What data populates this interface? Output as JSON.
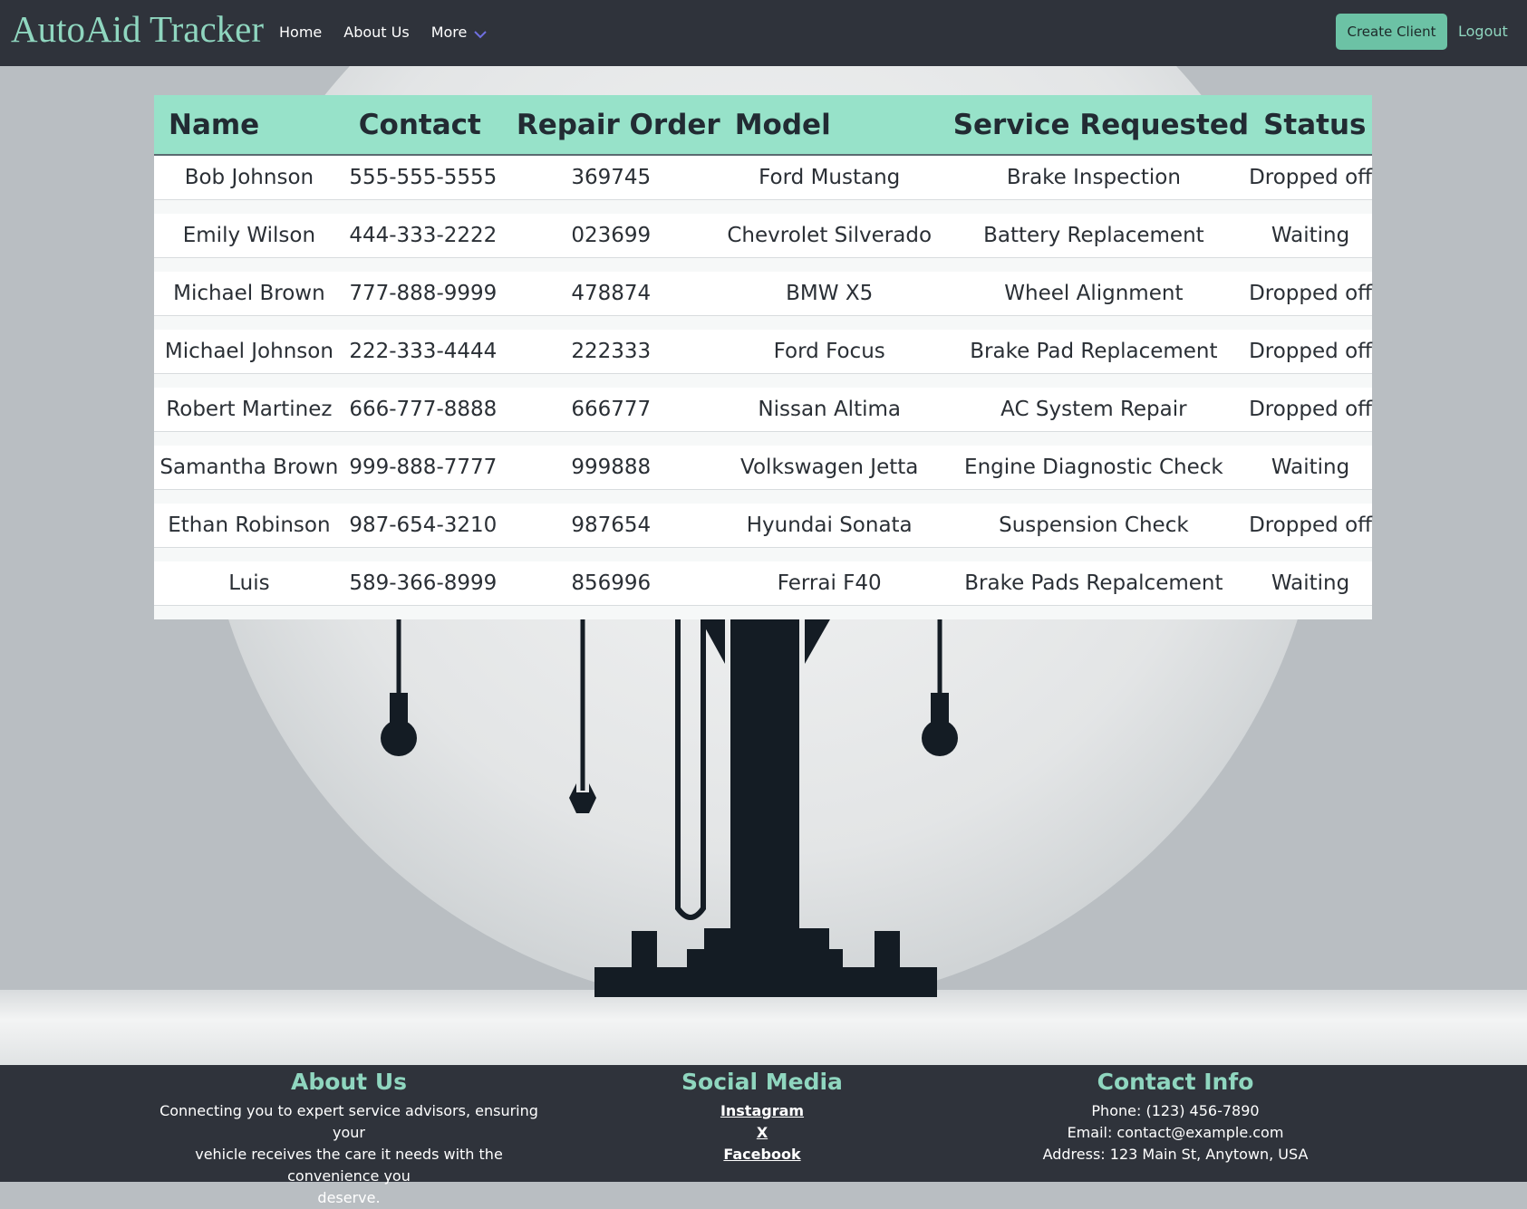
{
  "nav": {
    "brand": "AutoAid Tracker",
    "links": [
      "Home",
      "About Us",
      "More"
    ],
    "create_label": "Create Client",
    "logout_label": "Logout"
  },
  "table": {
    "headers": [
      "Name",
      "Contact",
      "Repair Order",
      "Model",
      "Service Requested",
      "Status"
    ],
    "rows": [
      [
        "Bob Johnson",
        "555-555-5555",
        "369745",
        "Ford Mustang",
        "Brake Inspection",
        "Dropped off"
      ],
      [
        "Emily Wilson",
        "444-333-2222",
        "023699",
        "Chevrolet Silverado",
        "Battery Replacement",
        "Waiting"
      ],
      [
        "Michael Brown",
        "777-888-9999",
        "478874",
        "BMW X5",
        "Wheel Alignment",
        "Dropped off"
      ],
      [
        "Michael Johnson",
        "222-333-4444",
        "222333",
        "Ford Focus",
        "Brake Pad Replacement",
        "Dropped off"
      ],
      [
        "Robert Martinez",
        "666-777-8888",
        "666777",
        "Nissan Altima",
        "AC System Repair",
        "Dropped off"
      ],
      [
        "Samantha Brown",
        "999-888-7777",
        "999888",
        "Volkswagen Jetta",
        "Engine Diagnostic Check",
        "Waiting"
      ],
      [
        "Ethan Robinson",
        "987-654-3210",
        "987654",
        "Hyundai Sonata",
        "Suspension Check",
        "Dropped off"
      ],
      [
        "Luis",
        "589-366-8999",
        "856996",
        "Ferrai F40",
        "Brake Pads Repalcement",
        "Waiting"
      ]
    ]
  },
  "footer": {
    "about": {
      "title": "About Us",
      "text_lines": [
        "Connecting you to expert service advisors, ensuring your",
        "vehicle receives the care it needs with the convenience you",
        "deserve."
      ]
    },
    "social": {
      "title": "Social Media",
      "links": [
        "Instagram",
        "X",
        "Facebook"
      ]
    },
    "contact": {
      "title": "Contact Info",
      "phone": "Phone: (123) 456-7890",
      "email": "Email: contact@example.com",
      "address": "Address: 123 Main St, Anytown, USA"
    }
  },
  "colors": {
    "accent": "#8fd6bf",
    "header_bg": "#97e2c9",
    "nav_bg": "#2f333b"
  }
}
